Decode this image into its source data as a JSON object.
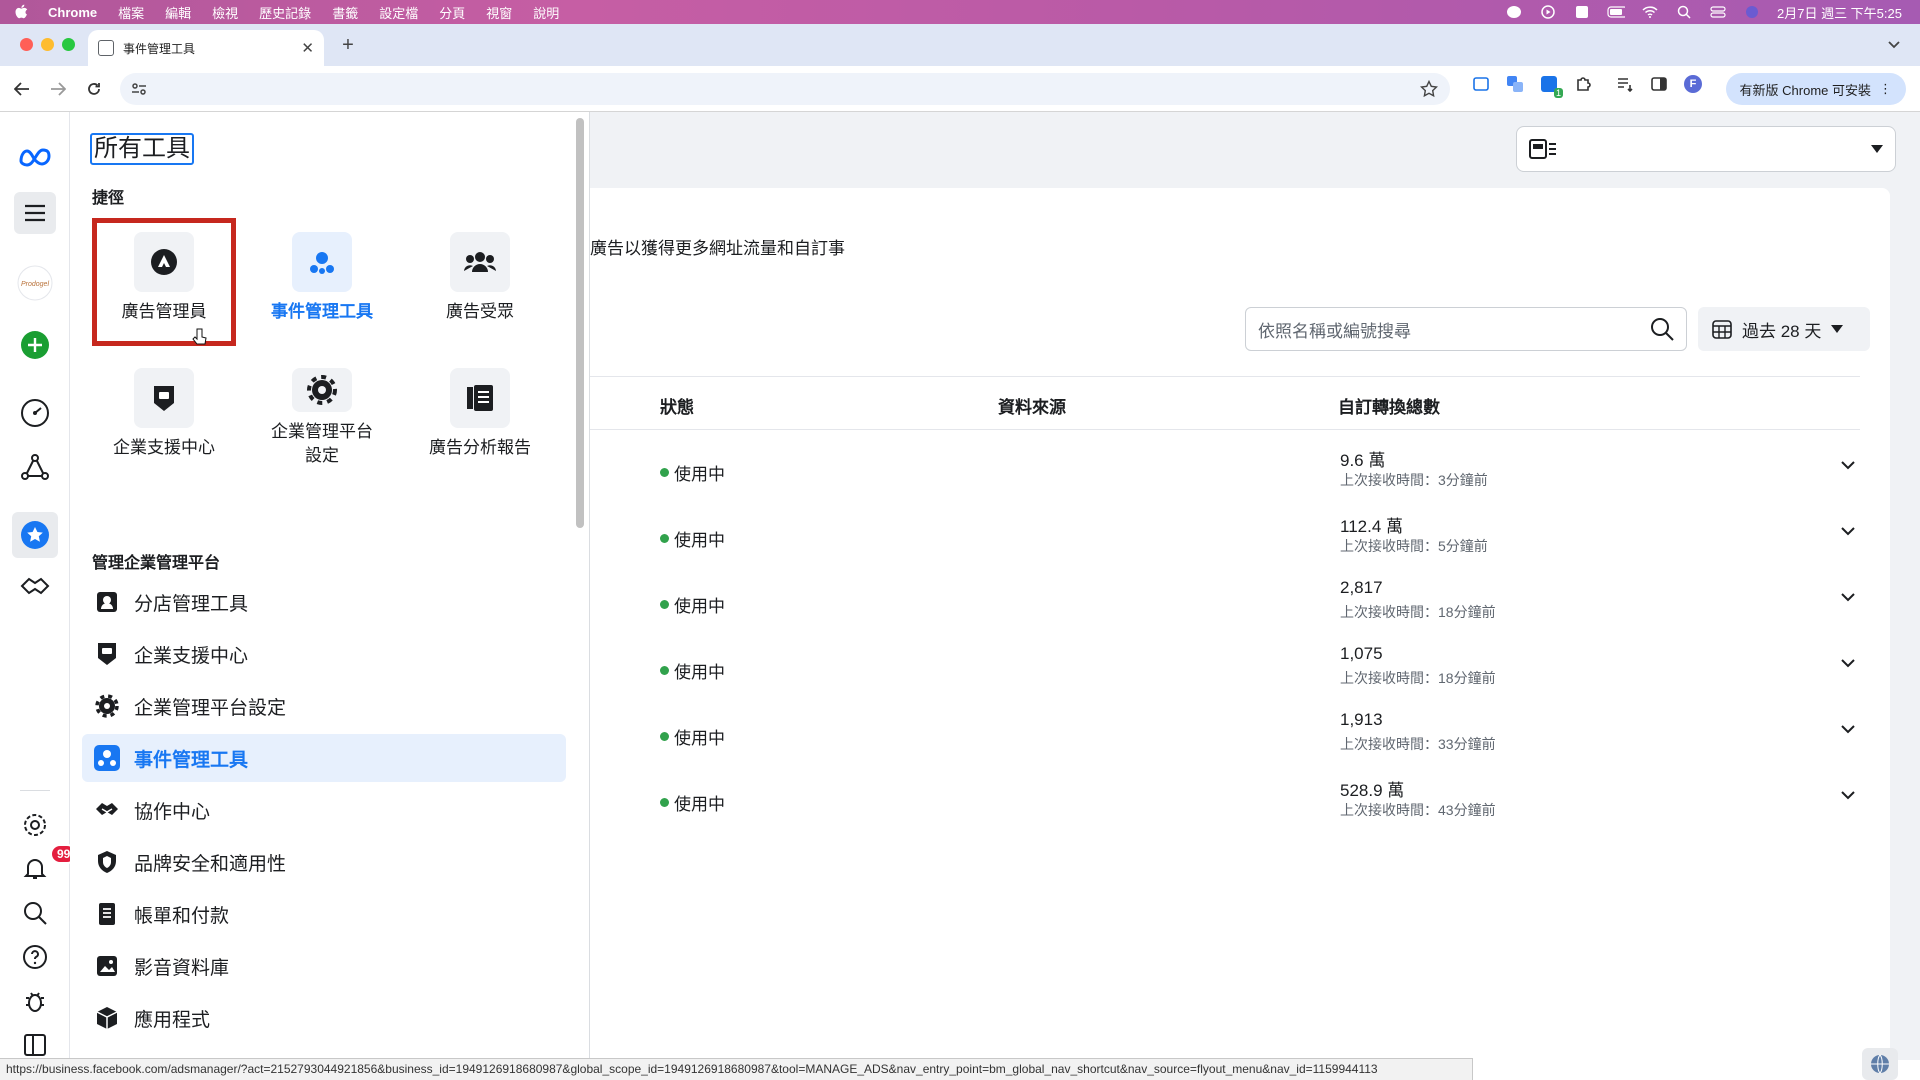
{
  "menubar": {
    "app": "Chrome",
    "items": [
      "檔案",
      "編輯",
      "檢視",
      "歷史記錄",
      "書籤",
      "設定檔",
      "分頁",
      "視窗",
      "說明"
    ],
    "clock": "2月7日 週三 下午5:25"
  },
  "browser": {
    "tab_title": "事件管理工具",
    "update_label": "有新版 Chrome 可安裝",
    "profile_initial": "F",
    "extension_badge": "1"
  },
  "global_nav": {
    "notification_count": "99",
    "brand_logo_text": "Prodogel"
  },
  "flyout": {
    "title": "所有工具",
    "shortcuts_label": "捷徑",
    "shortcuts": [
      {
        "label": "廣告管理員",
        "icon": "ads-manager-icon"
      },
      {
        "label": "事件管理工具",
        "icon": "events-manager-icon"
      },
      {
        "label": "廣告受眾",
        "icon": "audiences-icon"
      },
      {
        "label": "企業支援中心",
        "icon": "support-shield-icon"
      },
      {
        "label": "企業管理平台\n設定",
        "icon": "gear-icon"
      },
      {
        "label": "廣告分析報告",
        "icon": "reports-icon"
      }
    ],
    "manage_label": "管理企業管理平台",
    "manage_items": [
      {
        "label": "分店管理工具",
        "icon": "location-pin-icon"
      },
      {
        "label": "企業支援中心",
        "icon": "support-shield-icon"
      },
      {
        "label": "企業管理平台設定",
        "icon": "gear-icon"
      },
      {
        "label": "事件管理工具",
        "icon": "events-manager-icon",
        "active": true
      },
      {
        "label": "協作中心",
        "icon": "handshake-icon"
      },
      {
        "label": "品牌安全和適用性",
        "icon": "brand-safety-icon"
      },
      {
        "label": "帳單和付款",
        "icon": "billing-icon"
      },
      {
        "label": "影音資料庫",
        "icon": "media-library-icon"
      },
      {
        "label": "應用程式",
        "icon": "apps-cube-icon"
      }
    ]
  },
  "main": {
    "promo_text": "廣告以獲得更多網址流量和自訂事",
    "search_placeholder": "依照名稱或編號搜尋",
    "date_range": "過去 28 天",
    "columns": {
      "status": "狀態",
      "source": "資料來源",
      "total": "自訂轉換總數"
    },
    "rows": [
      {
        "status": "使用中",
        "value": "9.6 萬",
        "last": "上次接收時間：3分鐘前"
      },
      {
        "status": "使用中",
        "value": "112.4 萬",
        "last": "上次接收時間：5分鐘前"
      },
      {
        "status": "使用中",
        "value": "2,817",
        "last": "上次接收時間：18分鐘前"
      },
      {
        "status": "使用中",
        "value": "1,075",
        "last": "上次接收時間：18分鐘前"
      },
      {
        "status": "使用中",
        "value": "1,913",
        "last": "上次接收時間：33分鐘前"
      },
      {
        "status": "使用中",
        "value": "528.9 萬",
        "last": "上次接收時間：43分鐘前"
      }
    ]
  },
  "status_url": "https://business.facebook.com/adsmanager/?act=2152793044921856&business_id=1949126918680987&global_scope_id=1949126918680987&tool=MANAGE_ADS&nav_entry_point=bm_global_nav_shortcut&nav_source=flyout_menu&nav_id=1159944113",
  "colors": {
    "accent": "#1877f2",
    "active_bg": "#e7f0fd",
    "status_green": "#31a24c",
    "highlight_border": "#c6281e"
  }
}
